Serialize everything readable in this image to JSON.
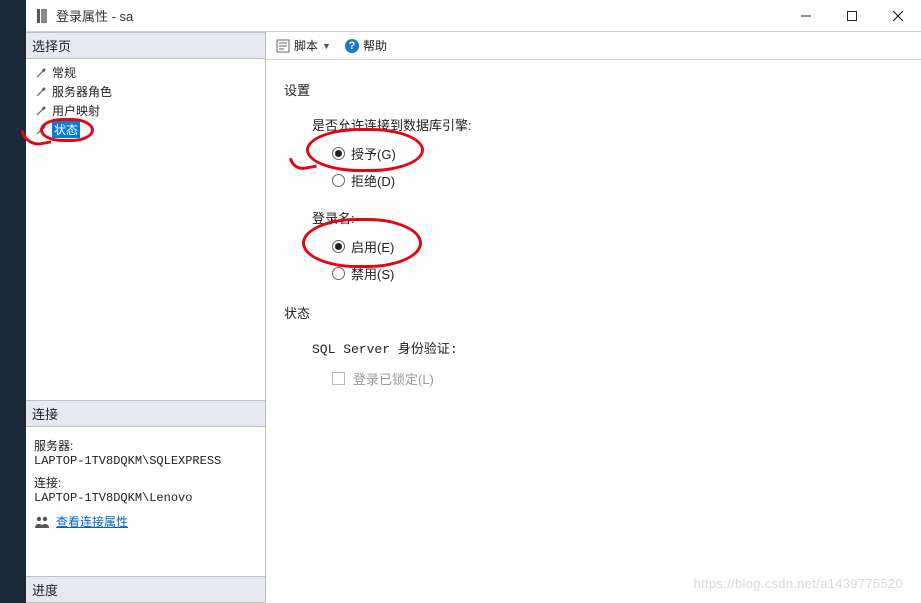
{
  "window": {
    "title": "登录属性 - sa"
  },
  "sidebar": {
    "select_page": "选择页",
    "items": [
      {
        "label": "常规"
      },
      {
        "label": "服务器角色"
      },
      {
        "label": "用户映射"
      },
      {
        "label": "状态",
        "selected": true
      }
    ],
    "connection": {
      "header": "连接",
      "server_label": "服务器:",
      "server_value": "LAPTOP-1TV8DQKM\\SQLEXPRESS",
      "conn_label": "连接:",
      "conn_value": "LAPTOP-1TV8DQKM\\Lenovo",
      "view_props": "查看连接属性"
    },
    "progress": {
      "header": "进度"
    }
  },
  "toolbar": {
    "script": "脚本",
    "help": "帮助"
  },
  "main": {
    "settings": "设置",
    "allow_connect_label": "是否允许连接到数据库引擎:",
    "grant": "授予(G)",
    "deny": "拒绝(D)",
    "login_label": "登录名:",
    "enable": "启用(E)",
    "disable": "禁用(S)",
    "status": "状态",
    "sql_auth": "SQL Server 身份验证:",
    "locked": "登录已锁定(L)"
  },
  "watermark": "https://blog.csdn.net/a1439775520"
}
